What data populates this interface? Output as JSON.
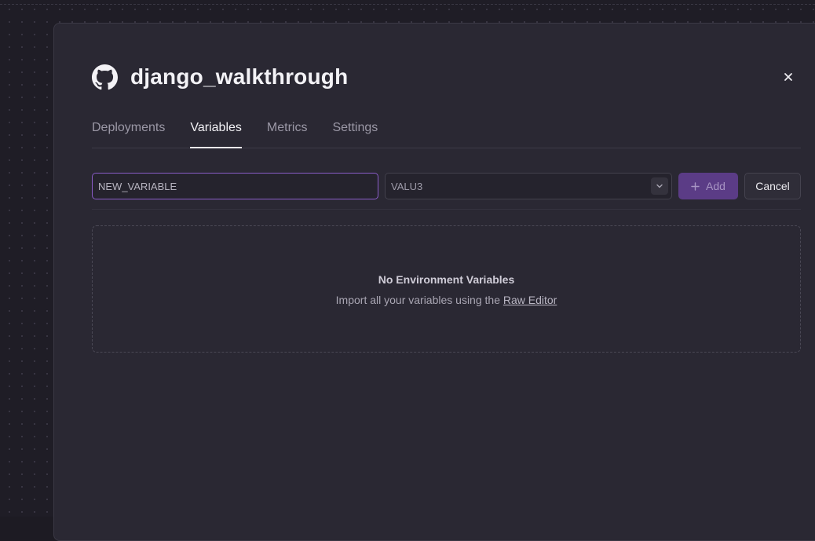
{
  "project": {
    "title": "django_walkthrough",
    "icon": "github-icon"
  },
  "tabs": [
    {
      "label": "Deployments",
      "active": false
    },
    {
      "label": "Variables",
      "active": true
    },
    {
      "label": "Metrics",
      "active": false
    },
    {
      "label": "Settings",
      "active": false
    }
  ],
  "form": {
    "name_value": "NEW_VARIABLE",
    "value_value": "VALU3",
    "add_label": "Add",
    "cancel_label": "Cancel"
  },
  "empty_state": {
    "title": "No Environment Variables",
    "subtitle": "Import all your variables using the",
    "link_label": "Raw Editor"
  },
  "colors": {
    "accent": "#8a5cc8",
    "add_button": "#5b3c86",
    "panel": "#2a2833"
  }
}
